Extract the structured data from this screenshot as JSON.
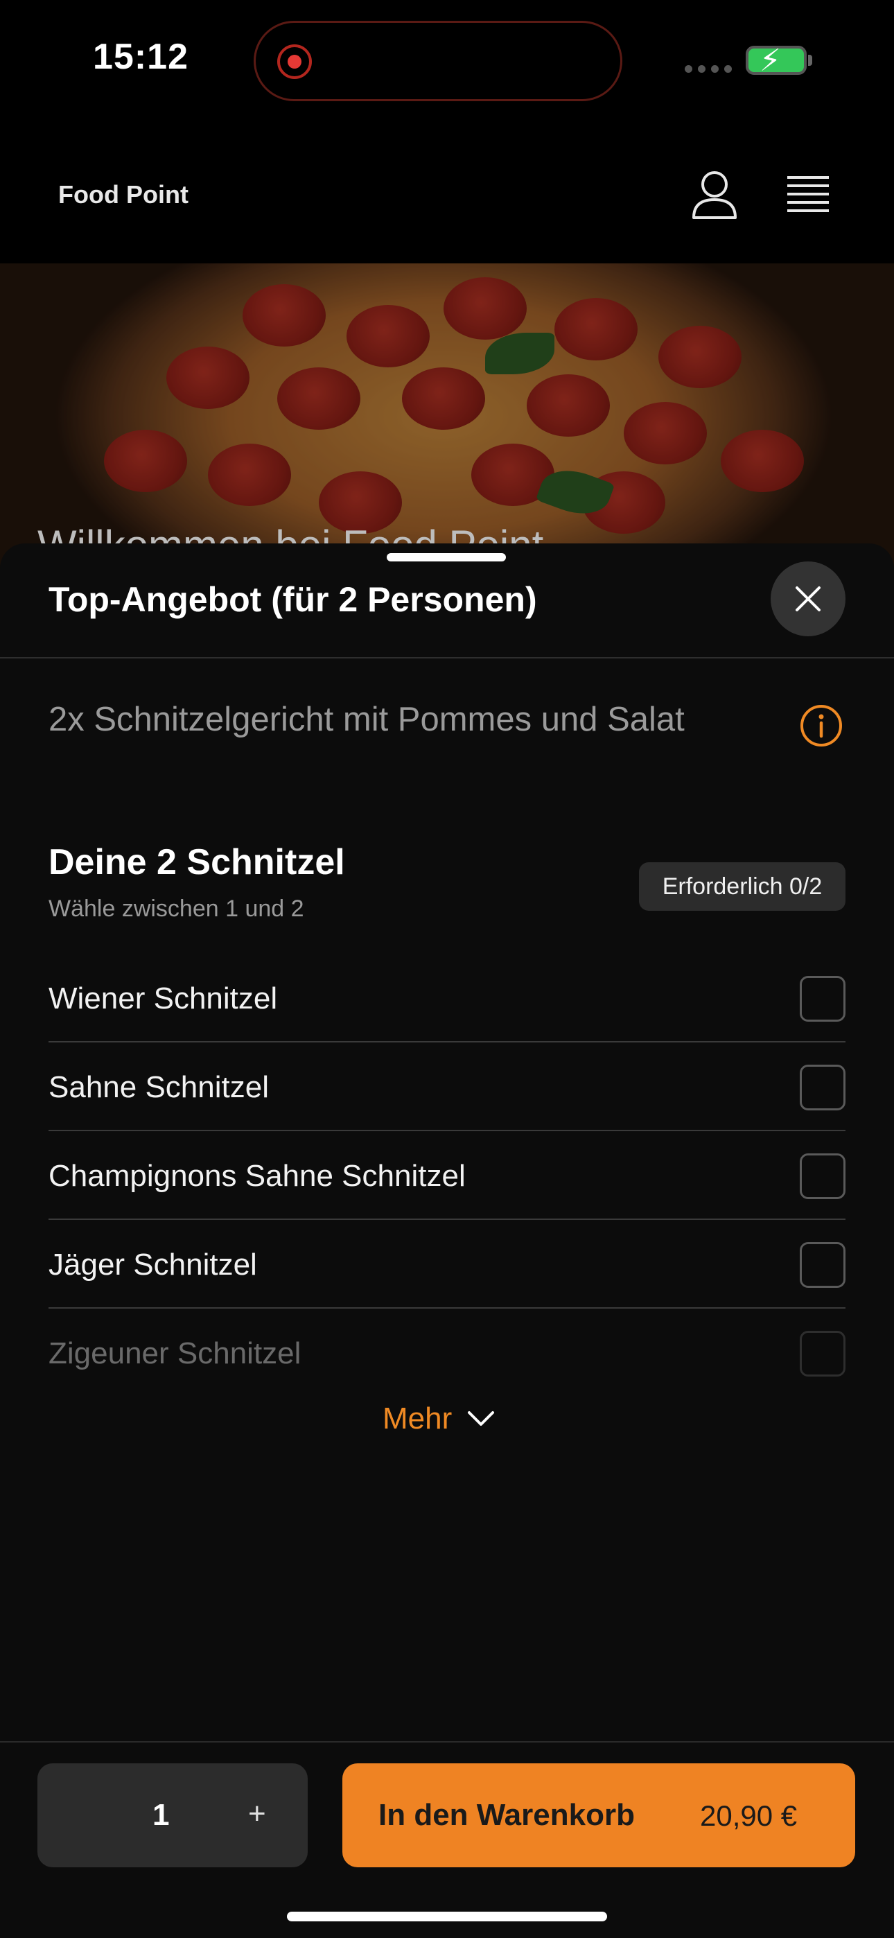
{
  "status_bar": {
    "time": "15:12"
  },
  "header": {
    "brand": "Food Point"
  },
  "hero": {
    "text": "Willkommen bei Food Point"
  },
  "sheet": {
    "title": "Top-Angebot (für 2 Personen)",
    "description": "2x Schnitzelgericht mit Pommes und Salat",
    "group": {
      "title": "Deine 2 Schnitzel",
      "subtitle": "Wähle zwischen 1 und 2",
      "badge": "Erforderlich 0/2",
      "options": [
        {
          "label": "Wiener Schnitzel",
          "checked": false
        },
        {
          "label": "Sahne Schnitzel",
          "checked": false
        },
        {
          "label": "Champignons Sahne Schnitzel",
          "checked": false
        },
        {
          "label": "Jäger Schnitzel",
          "checked": false
        },
        {
          "label": "Zigeuner Schnitzel",
          "checked": false
        }
      ]
    },
    "more_label": "Mehr"
  },
  "footer": {
    "quantity": "1",
    "plus_label": "+",
    "cart_label": "In den Warenkorb",
    "price": "20,90 €"
  },
  "colors": {
    "accent": "#ef8323",
    "background": "#000000"
  }
}
